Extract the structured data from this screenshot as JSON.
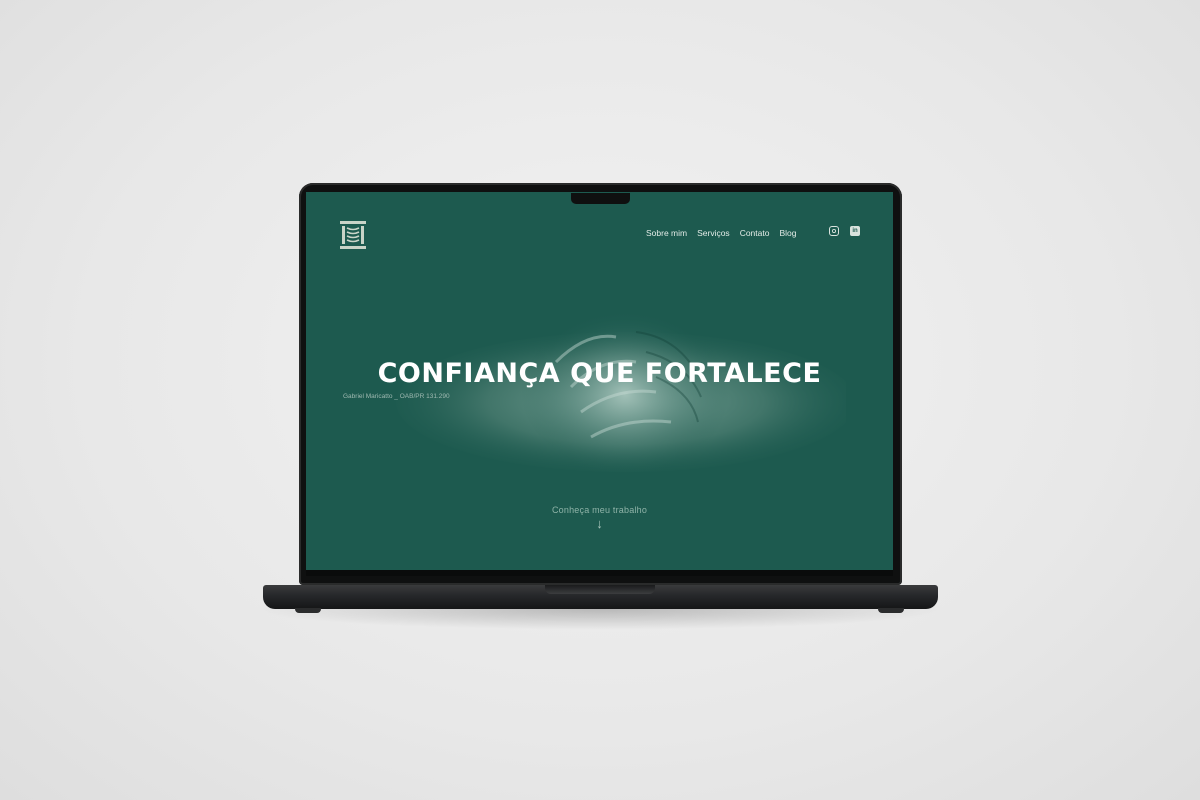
{
  "nav": {
    "items": [
      "Sobre mim",
      "Serviços",
      "Contato",
      "Blog"
    ]
  },
  "socials": {
    "instagram_icon": "instagram-icon",
    "linkedin_icon": "linkedin-icon",
    "linkedin_text": "in"
  },
  "hero": {
    "headline": "CONFIANÇA QUE FORTALECE",
    "subtitle": "Gabriel Maricatto _ OAB/PR 131.290",
    "cta": "Conheça meu trabalho",
    "arrow": "↓"
  },
  "colors": {
    "screen_bg": "#1d5a4f",
    "text": "#ffffff",
    "muted": "#8fb3a8"
  }
}
